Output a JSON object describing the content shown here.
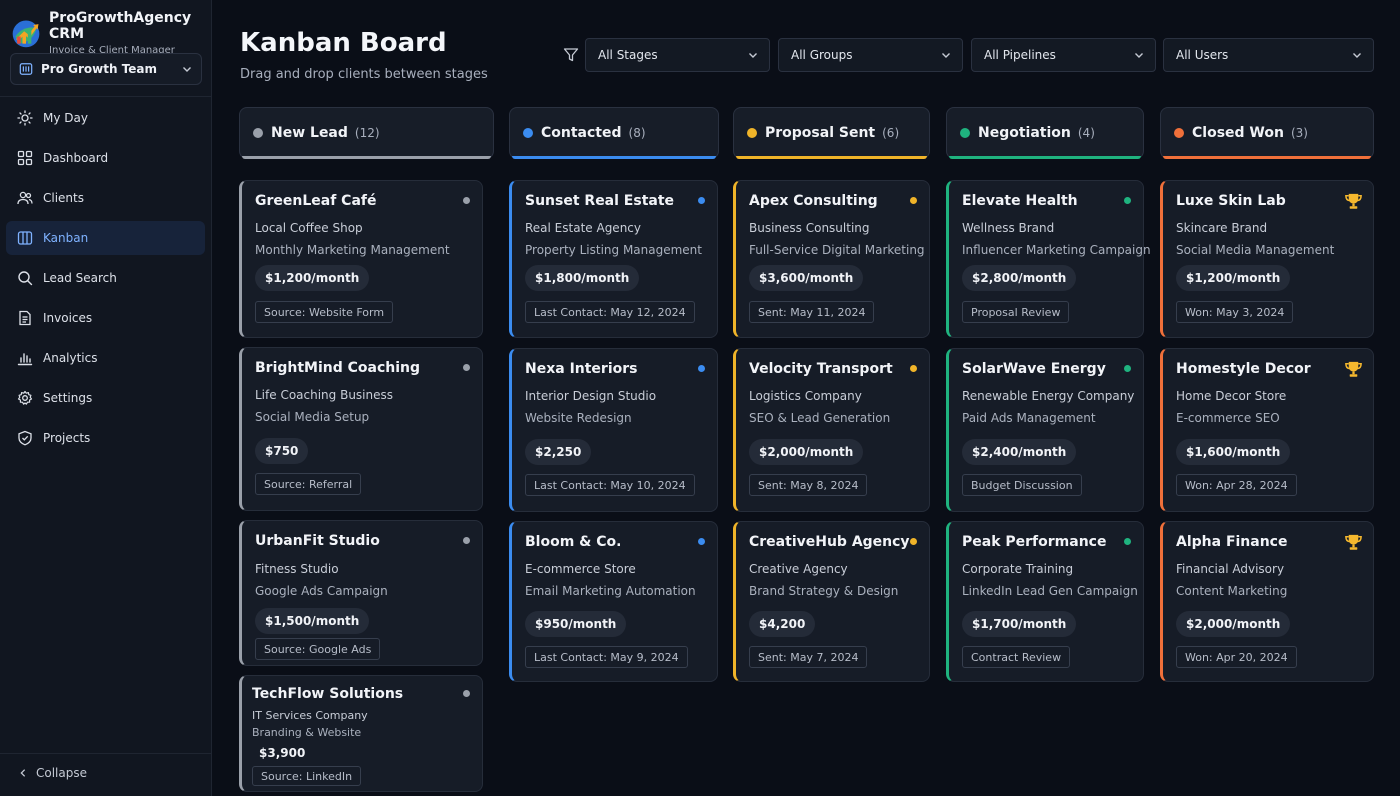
{
  "brand": {
    "title": "ProGrowthAgency CRM",
    "subtitle": "Invoice & Client Manager"
  },
  "team": {
    "label": "Pro Growth Team"
  },
  "nav": [
    {
      "label": "My Day",
      "icon": "sun-icon"
    },
    {
      "label": "Dashboard",
      "icon": "grid-icon"
    },
    {
      "label": "Clients",
      "icon": "users-icon"
    },
    {
      "label": "Kanban",
      "icon": "kanban-icon",
      "active": true
    },
    {
      "label": "Lead Search",
      "icon": "search-icon"
    },
    {
      "label": "Invoices",
      "icon": "document-icon"
    },
    {
      "label": "Analytics",
      "icon": "bar-chart-icon"
    },
    {
      "label": "Settings",
      "icon": "gear-icon"
    },
    {
      "label": "Projects",
      "icon": "shield-check-icon"
    }
  ],
  "collapse_label": "Collapse",
  "header": {
    "title": "Kanban Board",
    "subtitle": "Drag and drop clients between stages"
  },
  "filters": [
    "All Stages",
    "All Groups",
    "All Pipelines",
    "All Users"
  ],
  "columns": [
    {
      "title": "New Lead",
      "count": "(12)",
      "color": "#9aa0aa",
      "marker": "dot",
      "cards": [
        {
          "name": "GreenLeaf Café",
          "type": "Local Coffee Shop",
          "service": "Monthly Marketing Management",
          "price": "$1,200/month",
          "tag": "Source: Website Form"
        },
        {
          "name": "BrightMind Coaching",
          "type": "Life Coaching Business",
          "service": "Social Media Setup",
          "price": "$750",
          "tag": "Source: Referral"
        },
        {
          "name": "UrbanFit Studio",
          "type": "Fitness Studio",
          "service": "Google Ads Campaign",
          "price": "$1,500/month",
          "tag": "Source: Google Ads"
        },
        {
          "name": "TechFlow Solutions",
          "type": "IT Services Company",
          "service": "Branding & Website",
          "price": "$3,900",
          "tag": "Source: LinkedIn"
        }
      ]
    },
    {
      "title": "Contacted",
      "count": "(8)",
      "color": "#3b8cf0",
      "marker": "dot",
      "cards": [
        {
          "name": "Sunset Real Estate",
          "type": "Real Estate Agency",
          "service": "Property Listing Management",
          "price": "$1,800/month",
          "tag": "Last Contact: May 12, 2024"
        },
        {
          "name": "Nexa Interiors",
          "type": "Interior Design Studio",
          "service": "Website Redesign",
          "price": "$2,250",
          "tag": "Last Contact: May 10, 2024"
        },
        {
          "name": "Bloom & Co.",
          "type": "E-commerce Store",
          "service": "Email Marketing Automation",
          "price": "$950/month",
          "tag": "Last Contact: May 9, 2024"
        }
      ]
    },
    {
      "title": "Proposal Sent",
      "count": "(6)",
      "color": "#f0b429",
      "marker": "dot",
      "cards": [
        {
          "name": "Apex Consulting",
          "type": "Business Consulting",
          "service": "Full-Service Digital Marketing",
          "price": "$3,600/month",
          "tag": "Sent: May 11, 2024"
        },
        {
          "name": "Velocity Transport",
          "type": "Logistics Company",
          "service": "SEO & Lead Generation",
          "price": "$2,000/month",
          "tag": "Sent: May 8, 2024"
        },
        {
          "name": "CreativeHub Agency",
          "type": "Creative Agency",
          "service": "Brand Strategy & Design",
          "price": "$4,200",
          "tag": "Sent: May 7, 2024"
        }
      ]
    },
    {
      "title": "Negotiation",
      "count": "(4)",
      "color": "#1fb37f",
      "marker": "dot",
      "cards": [
        {
          "name": "Elevate Health",
          "type": "Wellness Brand",
          "service": "Influencer Marketing Campaign",
          "price": "$2,800/month",
          "tag": "Proposal Review"
        },
        {
          "name": "SolarWave Energy",
          "type": "Renewable Energy Company",
          "service": "Paid Ads Management",
          "price": "$2,400/month",
          "tag": "Budget Discussion"
        },
        {
          "name": "Peak Performance",
          "type": "Corporate Training",
          "service": "LinkedIn Lead Gen Campaign",
          "price": "$1,700/month",
          "tag": "Contract Review"
        }
      ]
    },
    {
      "title": "Closed Won",
      "count": "(3)",
      "color": "#f0703a",
      "marker": "trophy",
      "cards": [
        {
          "name": "Luxe Skin Lab",
          "type": "Skincare Brand",
          "service": "Social Media Management",
          "price": "$1,200/month",
          "tag": "Won: May 3, 2024"
        },
        {
          "name": "Homestyle Decor",
          "type": "Home Decor Store",
          "service": "E-commerce SEO",
          "price": "$1,600/month",
          "tag": "Won: Apr 28, 2024"
        },
        {
          "name": "Alpha Finance",
          "type": "Financial Advisory",
          "service": "Content Marketing",
          "price": "$2,000/month",
          "tag": "Won: Apr 20, 2024"
        }
      ]
    }
  ]
}
